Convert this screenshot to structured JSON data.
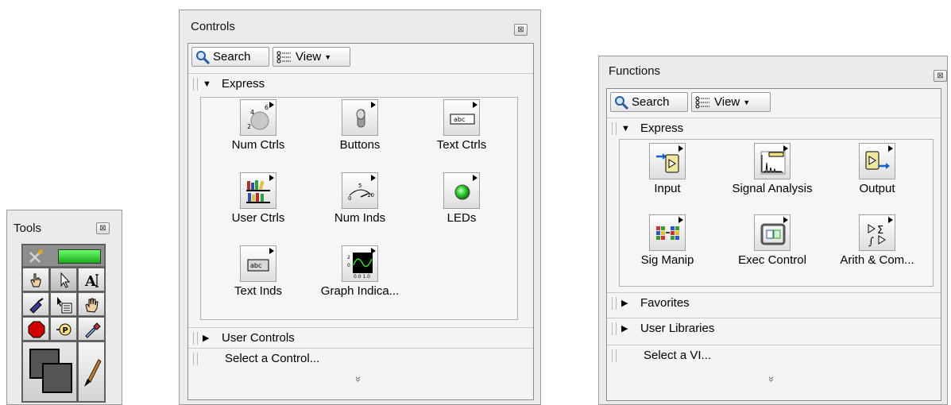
{
  "tools": {
    "title": "Tools",
    "close": "⊠",
    "items": [
      "auto-tool",
      "operate-tool",
      "position-tool",
      "text-tool",
      "wire-tool",
      "shortcut-menu-tool",
      "scroll-tool",
      "breakpoint-tool",
      "probe-tool",
      "color-copy-tool",
      "color-tool",
      "paint-brush-tool"
    ]
  },
  "controls": {
    "title": "Controls",
    "close": "⊠",
    "search_label": "Search",
    "view_label": "View",
    "express_label": "Express",
    "items": [
      {
        "label": "Num Ctrls",
        "icon": "knob-icon"
      },
      {
        "label": "Buttons",
        "icon": "toggle-switch-icon"
      },
      {
        "label": "Text Ctrls",
        "icon": "text-control-icon"
      },
      {
        "label": "User Ctrls",
        "icon": "bookshelf-icon"
      },
      {
        "label": "Num Inds",
        "icon": "gauge-icon"
      },
      {
        "label": "LEDs",
        "icon": "led-icon"
      },
      {
        "label": "Text Inds",
        "icon": "text-indicator-icon"
      },
      {
        "label": "Graph Indica...",
        "icon": "graph-icon"
      }
    ],
    "user_controls_label": "User Controls",
    "select_label": "Select a Control...",
    "more": "»"
  },
  "functions": {
    "title": "Functions",
    "close": "⊠",
    "search_label": "Search",
    "view_label": "View",
    "express_label": "Express",
    "items": [
      {
        "label": "Input",
        "icon": "input-icon"
      },
      {
        "label": "Signal Analysis",
        "icon": "signal-analysis-icon"
      },
      {
        "label": "Output",
        "icon": "output-icon"
      },
      {
        "label": "Sig Manip",
        "icon": "signal-manipulation-icon"
      },
      {
        "label": "Exec Control",
        "icon": "exec-control-icon"
      },
      {
        "label": "Arith & Com...",
        "icon": "arithmetic-icon"
      }
    ],
    "favorites_label": "Favorites",
    "user_libraries_label": "User Libraries",
    "select_label": "Select a VI...",
    "more": "»"
  }
}
